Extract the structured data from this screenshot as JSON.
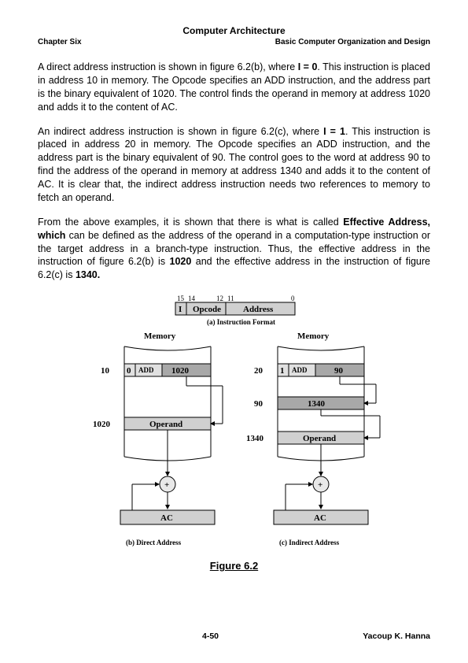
{
  "header": {
    "title": "Computer Architecture",
    "left": "Chapter Six",
    "right": "Basic Computer Organization and Design"
  },
  "para1_a": "A direct address instruction is shown in figure 6.2(b), where ",
  "para1_b": "I = 0",
  "para1_c": ". This instruction is placed in address 10 in memory. The Opcode specifies an ADD instruction, and the address part is the binary equivalent of 1020. The control finds the operand in memory at address 1020 and adds it to the content of AC.",
  "para2_a": "An indirect address instruction is shown in figure 6.2(c), where ",
  "para2_b": "I = 1",
  "para2_c": ". This instruction is placed in address 20 in memory. The Opcode specifies an ADD instruction, and the address part is the binary equivalent of 90. The control goes to the word at address 90 to find the address of the operand in memory at address 1340 and adds it to the content of AC. It is clear that, the indirect address instruction needs two references to memory to fetch an operand.",
  "para3_a": "From the above examples, it is shown that there is what is called ",
  "para3_b": "Effective Address, which ",
  "para3_c": "can be defined as the address of the operand in a computation-type instruction or the target address in a branch-type instruction. Thus, the effective address in the instruction of figure 6.2(b) is ",
  "para3_d": "1020",
  "para3_e": " and the effective address in the instruction of figure 6.2(c) is ",
  "para3_f": "1340.",
  "figure": {
    "caption": "Figure 6.2",
    "part_a": {
      "bits": {
        "b15": "15",
        "b14": "14",
        "b12": "12",
        "b11": "11",
        "b0": "0"
      },
      "I": "I",
      "opcode": "Opcode",
      "address": "Address",
      "caption": "(a) Instruction Format"
    },
    "part_b": {
      "mem_label": "Memory",
      "addr10": "10",
      "I": "0",
      "opcode": "ADD",
      "addr_val": "1020",
      "addr1020": "1020",
      "operand": "Operand",
      "plus": "+",
      "AC": "AC",
      "caption": "(b) Direct Address"
    },
    "part_c": {
      "mem_label": "Memory",
      "addr20": "20",
      "I": "1",
      "opcode": "ADD",
      "addr_val": "90",
      "addr90": "90",
      "val1340": "1340",
      "addr1340": "1340",
      "operand": "Operand",
      "plus": "+",
      "AC": "AC",
      "caption": "(c) Indirect Address"
    }
  },
  "footer": {
    "page": "4-50",
    "author": "Yacoup K. Hanna"
  }
}
